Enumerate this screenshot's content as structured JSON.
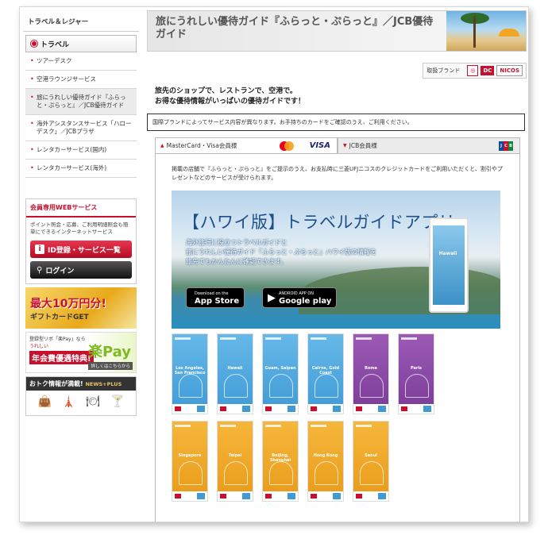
{
  "sidebar": {
    "heading": "トラベル＆レジャー",
    "travel_label": "トラベル",
    "items": [
      {
        "label": "ツアーデスク"
      },
      {
        "label": "空港ラウンジサービス"
      },
      {
        "label": "旅にうれしい優待ガイド『ふらっと・ぷらっと』／JCB優待ガイド"
      },
      {
        "label": "海外アシスタンスサービス「ハローデスク」／JCBプラザ"
      },
      {
        "label": "レンタカーサービス(国内)"
      },
      {
        "label": "レンタカーサービス(海外)"
      }
    ],
    "members": {
      "title": "会員専用WEBサービス",
      "desc": "ポイント照会・応募、ご利用明細照会も簡単にできるインターネットサービス",
      "id_button": "ID登録・サービス一覧",
      "login_button": "ログイン"
    },
    "banners": {
      "gift_big": "最大10万円分!",
      "gift_small": "ギフトカードGET",
      "pay_line1": "登録型リボ「楽Pay」なら",
      "pay_line2": "うれしい",
      "pay_line3": "年会費優遇特典!",
      "pay_brand": "楽Pay",
      "pay_more": "詳しくはこちらから",
      "news_title": "おトク情報が満載!",
      "news_sub": "NEWS+PLUS"
    }
  },
  "header": {
    "title": "旅にうれしい優待ガイド『ふらっと・ぷらっと』／JCB優待ガイド"
  },
  "brands": {
    "label": "取扱ブランド",
    "b1": "",
    "b2": "DC",
    "b3": "NICOS"
  },
  "lead": {
    "line1": "旅先のショップで、レストランで、空港で。",
    "line2": "お得な優待情報がいっぱいの優待ガイドです！"
  },
  "notice": "国際ブランドによってサービス内容が異なります。お手持ちのカードをご確認のうえ、ご利用ください。",
  "tabs": {
    "tab1": "MasterCard・Visa会員様",
    "tab2": "JCB会員様",
    "visa": "VISA",
    "jcb": "JCB"
  },
  "panel": {
    "desc": "掲載の店舗で『ふらっと・ぷらっと』をご提示のうえ、お支払時に三菱UFJニコスのクレジットカードをご利用いただくと、割引やプレゼントなどのサービスが受けられます。",
    "hero_title": "【ハワイ版】トラベルガイドアプリ",
    "hero_sub1": "海外旅行に役立つトラベルガイドと",
    "hero_sub2": "旅にうれしい優待ガイド『ふらっと・ぷらっと』ハワイ版の情報を",
    "hero_sub3": "旅先でもかんたんに確認できます。",
    "appstore_small": "Download on the",
    "appstore_big": "App Store",
    "gplay_small": "ANDROID APP ON",
    "gplay_big": "Google play",
    "phone_label": "Hawaii"
  },
  "guides": [
    {
      "name": "Los Angeles, San Francisco",
      "color": "blue"
    },
    {
      "name": "Hawaii",
      "color": "blue"
    },
    {
      "name": "Guam, Saipan",
      "color": "blue"
    },
    {
      "name": "Cairns, Gold Coast",
      "color": "blue"
    },
    {
      "name": "Roma",
      "color": "purple"
    },
    {
      "name": "Paris",
      "color": "purple"
    },
    {
      "name": "Singapore",
      "color": "orange"
    },
    {
      "name": "Taipei",
      "color": "orange"
    },
    {
      "name": "Beijing, Shanghai",
      "color": "orange"
    },
    {
      "name": "Hong Kong",
      "color": "orange"
    },
    {
      "name": "Seoul",
      "color": "orange"
    }
  ],
  "colors": {
    "brand_red": "#c8102e",
    "guide_blue": "#3f9ad6",
    "guide_purple": "#7a3b98",
    "guide_orange": "#e99a19"
  }
}
